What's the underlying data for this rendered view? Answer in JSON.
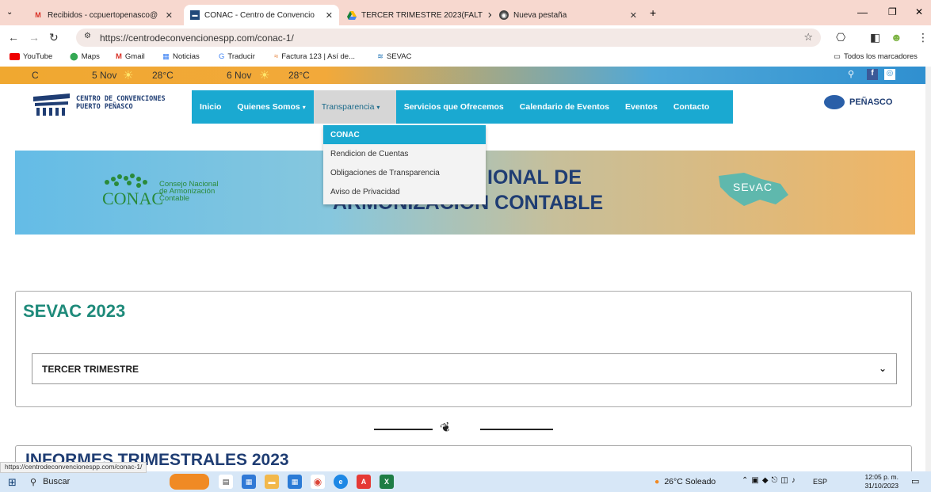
{
  "tabs": [
    {
      "title": "Recibidos - ccpuertopenasco@",
      "icon": "gmail-icon",
      "active": false
    },
    {
      "title": "CONAC - Centro de Convencio",
      "icon": "site-icon",
      "active": true
    },
    {
      "title": "TERCER TRIMESTRE 2023(FALT",
      "icon": "drive-icon",
      "active": false
    },
    {
      "title": "Nueva pestaña",
      "icon": "chrome-icon",
      "active": false
    }
  ],
  "address": {
    "url": "https://centrodeconvencionespp.com/conac-1/"
  },
  "bookmarks": [
    "YouTube",
    "Maps",
    "Gmail",
    "Noticias",
    "Traducir",
    "Factura 123 | Así de...",
    "SEVAC"
  ],
  "bookmarks_all": "Todos los marcadores",
  "weather": {
    "c": "C",
    "day1": "5 Nov",
    "temp1": "28°C",
    "day2": "6 Nov",
    "temp2": "28°C"
  },
  "site": {
    "logo_line1": "CENTRO DE CONVENCIONES",
    "logo_line2": "PUERTO PEÑASCO",
    "partner_logo": "PEÑASCO"
  },
  "nav": [
    "Inicio",
    "Quienes Somos",
    "Transparencia",
    "Servicios que Ofrecemos",
    "Calendario de Eventos",
    "Eventos",
    "Contacto"
  ],
  "dropdown": [
    "CONAC",
    "Rendicion de Cuentas",
    "Obligaciones de Transparencia",
    "Aviso de Privacidad"
  ],
  "banner": {
    "conac_title": "CONAC",
    "conac_sub1": "Consejo Nacional",
    "conac_sub2": "de Armonización",
    "conac_sub3": "Contable",
    "heading_line1": "IONAL DE",
    "heading_line2": "ARMONIZACION CONTABLE",
    "sevac_badge": "SEvAC"
  },
  "section1": {
    "title": "SEVAC 2023",
    "accordion": "TERCER TRIMESTRE"
  },
  "section2": {
    "title": "INFORMES TRIMESTRALES 2023"
  },
  "status_url": "https://centrodeconvencionespp.com/conac-1/",
  "taskbar": {
    "search": "Buscar",
    "weather": "26°C Soleado",
    "lang": "ESP",
    "time": "12:05 p. m.",
    "date": "31/10/2023"
  },
  "colors": {
    "accent": "#1aa9d1",
    "heading": "#1e8a7a"
  }
}
